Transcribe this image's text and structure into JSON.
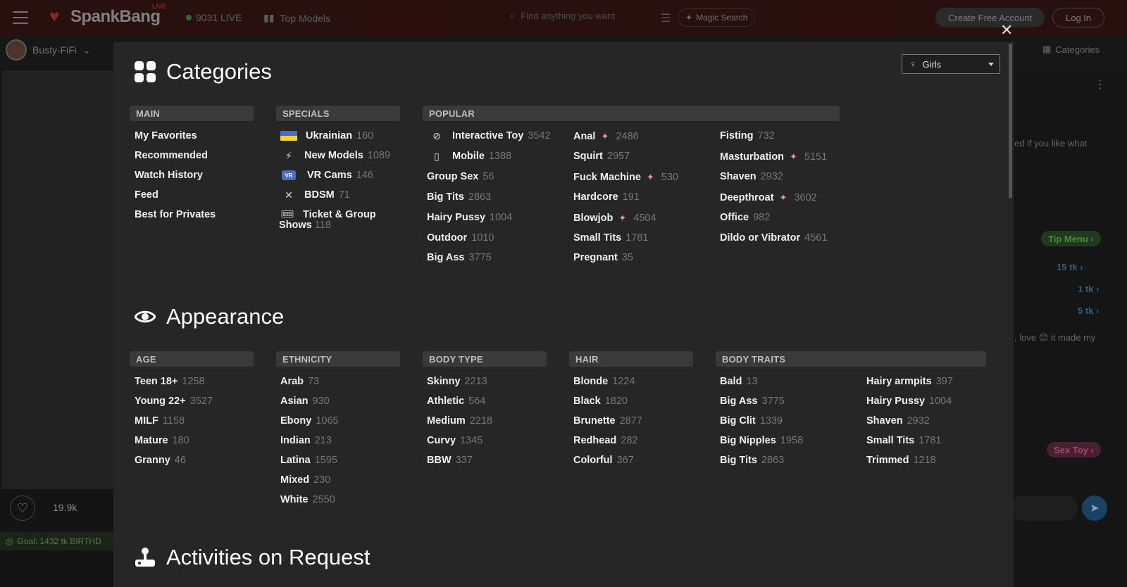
{
  "topbar": {
    "logo_text": "SpankBang",
    "logo_live": "LIVE",
    "live_count": "9031 LIVE",
    "top_models": "Top Models",
    "search_placeholder": "Find anything you want",
    "magic_search": "Magic Search",
    "create_account": "Create Free Account",
    "login": "Log In"
  },
  "background": {
    "model_name": "Busty-FiFi",
    "categories_label": "Categories",
    "like_count": "19.9k",
    "goal_text": "Goal: 1432 tk BIRTHD",
    "chat_text1": "ed if you like what",
    "chat_text2": ", love 😊 it made my",
    "tip_menu": "Tip Menu",
    "tip_rows": [
      "15 tk",
      "1 tk",
      "5 tk"
    ],
    "sex_toy": "Sex Toy"
  },
  "modal": {
    "gender_selected": "Girls",
    "close_symbol": "✕",
    "sections": {
      "categories": "Categories",
      "appearance": "Appearance",
      "activities": "Activities on Request"
    },
    "headers": {
      "main": "MAIN",
      "specials": "SPECIALS",
      "popular": "POPULAR",
      "age": "AGE",
      "ethnicity": "ETHNICITY",
      "body_type": "BODY TYPE",
      "hair": "HAIR",
      "body_traits": "BODY TRAITS"
    },
    "main": [
      "My Favorites",
      "Recommended",
      "Watch History",
      "Feed",
      "Best for Privates"
    ],
    "specials": [
      {
        "name": "Ukrainian",
        "count": "160",
        "icon": "ukraine-flag-icon"
      },
      {
        "name": "New Models",
        "count": "1089",
        "icon": "lightning-icon"
      },
      {
        "name": "VR Cams",
        "count": "146",
        "icon": "vr-icon"
      },
      {
        "name": "BDSM",
        "count": "71",
        "icon": "bdsm-icon"
      },
      {
        "name": "Ticket & Group Shows",
        "count": "118",
        "icon": "ticket-icon"
      }
    ],
    "popular_col1": [
      {
        "name": "Interactive Toy",
        "count": "3542",
        "icon": "interactive-toy-icon"
      },
      {
        "name": "Mobile",
        "count": "1388",
        "icon": "mobile-icon"
      },
      {
        "name": "Group Sex",
        "count": "56"
      },
      {
        "name": "Big Tits",
        "count": "2863"
      },
      {
        "name": "Hairy Pussy",
        "count": "1004"
      },
      {
        "name": "Outdoor",
        "count": "1010"
      },
      {
        "name": "Big Ass",
        "count": "3775"
      }
    ],
    "popular_col2": [
      {
        "name": "Anal",
        "count": "2486",
        "sparkle": true
      },
      {
        "name": "Squirt",
        "count": "2957"
      },
      {
        "name": "Fuck Machine",
        "count": "530",
        "sparkle": true
      },
      {
        "name": "Hardcore",
        "count": "191"
      },
      {
        "name": "Blowjob",
        "count": "4504",
        "sparkle": true
      },
      {
        "name": "Small Tits",
        "count": "1781"
      },
      {
        "name": "Pregnant",
        "count": "35"
      }
    ],
    "popular_col3": [
      {
        "name": "Fisting",
        "count": "732"
      },
      {
        "name": "Masturbation",
        "count": "5151",
        "sparkle": true
      },
      {
        "name": "Shaven",
        "count": "2932"
      },
      {
        "name": "Deepthroat",
        "count": "3602",
        "sparkle": true
      },
      {
        "name": "Office",
        "count": "982"
      },
      {
        "name": "Dildo or Vibrator",
        "count": "4561"
      }
    ],
    "age": [
      {
        "name": "Teen 18+",
        "count": "1258"
      },
      {
        "name": "Young 22+",
        "count": "3527"
      },
      {
        "name": "MILF",
        "count": "1158"
      },
      {
        "name": "Mature",
        "count": "180"
      },
      {
        "name": "Granny",
        "count": "46"
      }
    ],
    "ethnicity": [
      {
        "name": "Arab",
        "count": "73"
      },
      {
        "name": "Asian",
        "count": "930"
      },
      {
        "name": "Ebony",
        "count": "1065"
      },
      {
        "name": "Indian",
        "count": "213"
      },
      {
        "name": "Latina",
        "count": "1595"
      },
      {
        "name": "Mixed",
        "count": "230"
      },
      {
        "name": "White",
        "count": "2550"
      }
    ],
    "body_type": [
      {
        "name": "Skinny",
        "count": "2213"
      },
      {
        "name": "Athletic",
        "count": "564"
      },
      {
        "name": "Medium",
        "count": "2218"
      },
      {
        "name": "Curvy",
        "count": "1345"
      },
      {
        "name": "BBW",
        "count": "337"
      }
    ],
    "hair": [
      {
        "name": "Blonde",
        "count": "1224"
      },
      {
        "name": "Black",
        "count": "1820"
      },
      {
        "name": "Brunette",
        "count": "2877"
      },
      {
        "name": "Redhead",
        "count": "282"
      },
      {
        "name": "Colorful",
        "count": "367"
      }
    ],
    "body_traits_col1": [
      {
        "name": "Bald",
        "count": "13"
      },
      {
        "name": "Big Ass",
        "count": "3775"
      },
      {
        "name": "Big Clit",
        "count": "1339"
      },
      {
        "name": "Big Nipples",
        "count": "1958"
      },
      {
        "name": "Big Tits",
        "count": "2863"
      }
    ],
    "body_traits_col2": [
      {
        "name": "Hairy armpits",
        "count": "397"
      },
      {
        "name": "Hairy Pussy",
        "count": "1004"
      },
      {
        "name": "Shaven",
        "count": "2932"
      },
      {
        "name": "Small Tits",
        "count": "1781"
      },
      {
        "name": "Trimmed",
        "count": "1218"
      }
    ]
  },
  "colors": {
    "topbar_bg": "#3a0d0b",
    "modal_bg": "#262626",
    "header_bg": "#3a3a3a",
    "count_gray": "#777777",
    "sparkle_pink": "#f08fb0",
    "brand_red": "#e5372a"
  }
}
